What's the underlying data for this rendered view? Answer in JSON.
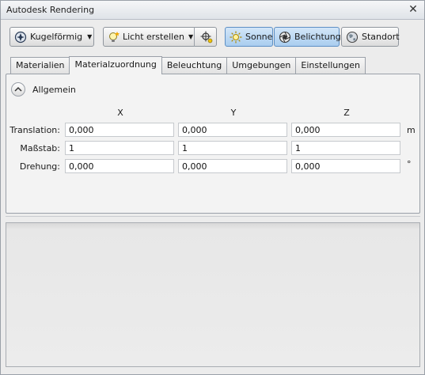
{
  "window": {
    "title": "Autodesk Rendering",
    "close_glyph": "✕"
  },
  "toolbar": {
    "mapping_button": {
      "label": "Kugelförmig",
      "icon": "sphere-map-icon"
    },
    "create_light_button": {
      "label": "Licht erstellen",
      "icon": "light-bulb-icon"
    },
    "light_target_icon": "crosshair-light-icon",
    "sun_button": {
      "label": "Sonne",
      "icon": "sun-icon",
      "active": true
    },
    "exposure_button": {
      "label": "Belichtung",
      "icon": "exposure-icon",
      "active": true
    },
    "location_button": {
      "label": "Standort",
      "icon": "globe-icon",
      "active": false
    }
  },
  "tabs": [
    {
      "label": "Materialien",
      "active": false
    },
    {
      "label": "Materialzuordnung",
      "active": true
    },
    {
      "label": "Beleuchtung",
      "active": false
    },
    {
      "label": "Umgebungen",
      "active": false
    },
    {
      "label": "Einstellungen",
      "active": false
    }
  ],
  "section": {
    "title": "Allgemein",
    "collapse_icon": "chevron-up-icon"
  },
  "columns": [
    "X",
    "Y",
    "Z"
  ],
  "rows": [
    {
      "label": "Translation:",
      "values": [
        "0,000",
        "0,000",
        "0,000"
      ],
      "unit": "m"
    },
    {
      "label": "Maßstab:",
      "values": [
        "1",
        "1",
        "1"
      ],
      "unit": ""
    },
    {
      "label": "Drehung:",
      "values": [
        "0,000",
        "0,000",
        "0,000"
      ],
      "unit": "°"
    }
  ],
  "colors": {
    "active_button": "#a9cdef",
    "window_border": "#9aa0a8"
  }
}
